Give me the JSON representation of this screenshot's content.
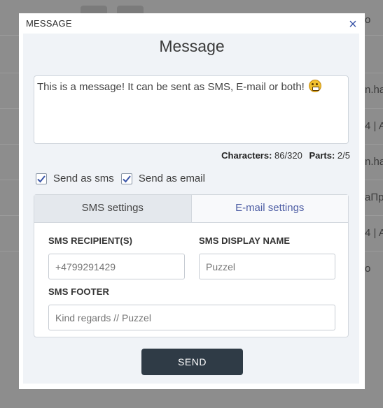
{
  "background": {
    "fragments": [
      "o",
      "n.ha",
      "4 | A",
      "n.ha",
      "аПро",
      "4 | A",
      "o"
    ]
  },
  "modal": {
    "tab_label": "MESSAGE",
    "close_icon": "close-icon",
    "title": "Message",
    "message_text": "This is a message! It can be sent as SMS, E-mail or both!",
    "emoji_icon": "grimacing-face-emoji",
    "counts": {
      "characters_label": "Characters:",
      "characters_value": "86/320",
      "parts_label": "Parts:",
      "parts_value": "2/5"
    },
    "send_as_sms_label": "Send as sms",
    "send_as_email_label": "Send as email",
    "tabs": {
      "sms_settings": "SMS settings",
      "email_settings": "E-mail settings"
    },
    "sms_recipients_label": "SMS RECIPIENT(S)",
    "sms_recipients_placeholder": "+4799291429",
    "sms_display_name_label": "SMS DISPLAY NAME",
    "sms_display_name_placeholder": "Puzzel",
    "sms_footer_label": "SMS FOOTER",
    "sms_footer_placeholder": "Kind regards // Puzzel",
    "send_label": "SEND"
  },
  "colors": {
    "accent": "#3b56a8",
    "send_button": "#2f3b46",
    "overlay": "#8c8c8c"
  }
}
